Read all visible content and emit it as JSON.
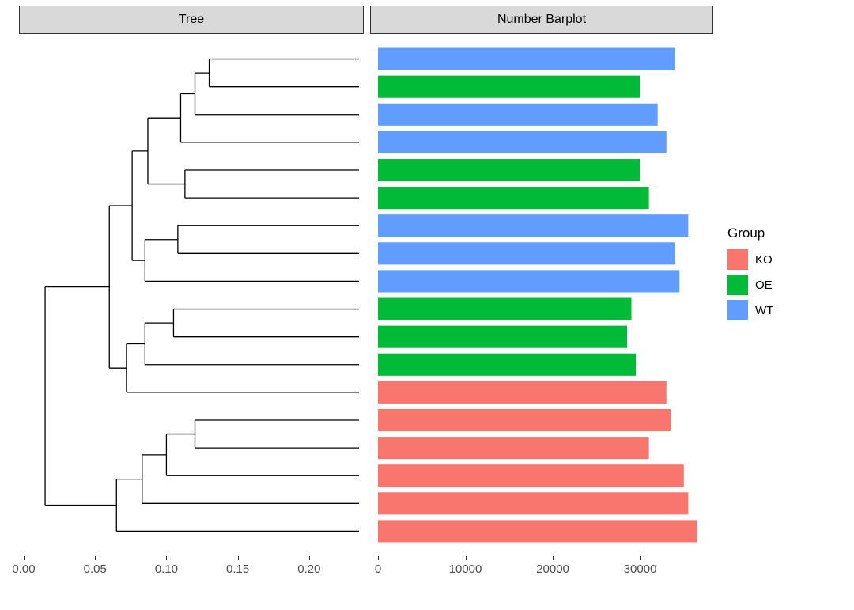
{
  "facets": {
    "tree": "Tree",
    "bar": "Number Barplot"
  },
  "legend": {
    "title": "Group",
    "items": [
      {
        "label": "KO",
        "color": "#F8766D"
      },
      {
        "label": "OE",
        "color": "#00BA38"
      },
      {
        "label": "WT",
        "color": "#619CFF"
      }
    ]
  },
  "tree_axis": {
    "ticks": [
      {
        "val": 0.0,
        "label": "0.00"
      },
      {
        "val": 0.05,
        "label": "0.05"
      },
      {
        "val": 0.1,
        "label": "0.10"
      },
      {
        "val": 0.15,
        "label": "0.15"
      },
      {
        "val": 0.2,
        "label": "0.20"
      }
    ]
  },
  "bar_axis": {
    "ticks": [
      {
        "val": 0,
        "label": "0"
      },
      {
        "val": 10000,
        "label": "10000"
      },
      {
        "val": 20000,
        "label": "20000"
      },
      {
        "val": 30000,
        "label": "30000"
      }
    ]
  },
  "chart_data": [
    {
      "type": "dendrogram",
      "title": "Tree",
      "xlabel": "",
      "ylabel": "",
      "xlim": [
        0,
        0.235
      ],
      "n_leaves": 18,
      "leaf_groups": [
        "WT",
        "OE",
        "WT",
        "WT",
        "OE",
        "OE",
        "WT",
        "WT",
        "WT",
        "OE",
        "OE",
        "OE",
        "KO",
        "KO",
        "KO",
        "KO",
        "KO",
        "KO"
      ],
      "merges": [
        {
          "left": "L1",
          "right": "L2",
          "height": 0.13,
          "id": "M1"
        },
        {
          "left": "M1",
          "right": "L3",
          "height": 0.12,
          "id": "M2"
        },
        {
          "left": "M2",
          "right": "L4",
          "height": 0.11,
          "id": "M3"
        },
        {
          "left": "L5",
          "right": "L6",
          "height": 0.113,
          "id": "M4"
        },
        {
          "left": "M3",
          "right": "M4",
          "height": 0.087,
          "id": "M5"
        },
        {
          "left": "L7",
          "right": "L8",
          "height": 0.108,
          "id": "M6"
        },
        {
          "left": "M6",
          "right": "L9",
          "height": 0.085,
          "id": "M7"
        },
        {
          "left": "M5",
          "right": "M7",
          "height": 0.076,
          "id": "M8"
        },
        {
          "left": "L10",
          "right": "L11",
          "height": 0.105,
          "id": "M9"
        },
        {
          "left": "M9",
          "right": "L12",
          "height": 0.085,
          "id": "M10"
        },
        {
          "left": "M10",
          "right": "L13",
          "height": 0.072,
          "id": "M11"
        },
        {
          "left": "M8",
          "right": "M11",
          "height": 0.06,
          "id": "M12"
        },
        {
          "left": "L14",
          "right": "L15",
          "height": 0.12,
          "id": "M13"
        },
        {
          "left": "M13",
          "right": "L16",
          "height": 0.1,
          "id": "M14"
        },
        {
          "left": "M14",
          "right": "L17",
          "height": 0.083,
          "id": "M15"
        },
        {
          "left": "M15",
          "right": "L18",
          "height": 0.065,
          "id": "M16"
        },
        {
          "left": "M12",
          "right": "M16",
          "height": 0.015,
          "id": "M17"
        }
      ],
      "tip_x": 0.235
    },
    {
      "type": "bar",
      "title": "Number Barplot",
      "orientation": "horizontal",
      "xlabel": "",
      "ylabel": "",
      "xlim": [
        0,
        38000
      ],
      "grid": false,
      "bars": [
        {
          "row": 1,
          "value": 34000,
          "group": "WT"
        },
        {
          "row": 2,
          "value": 30000,
          "group": "OE"
        },
        {
          "row": 3,
          "value": 32000,
          "group": "WT"
        },
        {
          "row": 4,
          "value": 33000,
          "group": "WT"
        },
        {
          "row": 5,
          "value": 30000,
          "group": "OE"
        },
        {
          "row": 6,
          "value": 31000,
          "group": "OE"
        },
        {
          "row": 7,
          "value": 35500,
          "group": "WT"
        },
        {
          "row": 8,
          "value": 34000,
          "group": "WT"
        },
        {
          "row": 9,
          "value": 34500,
          "group": "WT"
        },
        {
          "row": 10,
          "value": 29000,
          "group": "OE"
        },
        {
          "row": 11,
          "value": 28500,
          "group": "OE"
        },
        {
          "row": 12,
          "value": 29500,
          "group": "OE"
        },
        {
          "row": 13,
          "value": 33000,
          "group": "KO"
        },
        {
          "row": 14,
          "value": 33500,
          "group": "KO"
        },
        {
          "row": 15,
          "value": 31000,
          "group": "KO"
        },
        {
          "row": 16,
          "value": 35000,
          "group": "KO"
        },
        {
          "row": 17,
          "value": 35500,
          "group": "KO"
        },
        {
          "row": 18,
          "value": 36500,
          "group": "KO"
        }
      ]
    }
  ]
}
